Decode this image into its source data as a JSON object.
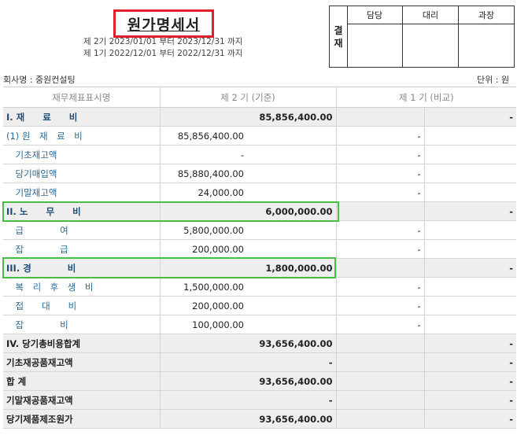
{
  "title": "원가명세서",
  "periods": {
    "line1": "제 2기 2023/01/01 부터 2023/12/31 까지",
    "line2": "제 1기 2022/12/01 부터 2022/12/31 까지"
  },
  "approval": {
    "label_top": "결",
    "label_bottom": "재",
    "columns": [
      "담당",
      "대리",
      "과장"
    ]
  },
  "company": "회사명 : 중원컨설팅",
  "unit": "단위 : 원",
  "headers": {
    "name": "재무제표표시명",
    "current": "제 2 기 (기준)",
    "prior": "제 1 기 (비교)"
  },
  "rows": [
    {
      "type": "sec",
      "label": "I. 재　　료　　비",
      "c1": "",
      "c2": "85,856,400.00",
      "p1": "",
      "p2": "-"
    },
    {
      "type": "item",
      "label": "(1) 원　재　료　비",
      "c1": "85,856,400.00",
      "c2": "",
      "p1": "-",
      "p2": ""
    },
    {
      "type": "item",
      "label": "　기초재고액",
      "c1": "-",
      "c2": "",
      "p1": "-",
      "p2": ""
    },
    {
      "type": "item",
      "label": "　당기매입액",
      "c1": "85,880,400.00",
      "c2": "",
      "p1": "-",
      "p2": ""
    },
    {
      "type": "item",
      "label": "　기말재고액",
      "c1": "24,000.00",
      "c2": "",
      "p1": "-",
      "p2": ""
    },
    {
      "type": "sec",
      "label": "II. 노　　무　　비",
      "c1": "",
      "c2": "6,000,000.00",
      "p1": "",
      "p2": "-"
    },
    {
      "type": "item",
      "label": "　급　　　　여",
      "c1": "5,800,000.00",
      "c2": "",
      "p1": "-",
      "p2": ""
    },
    {
      "type": "item",
      "label": "　잡　　　　급",
      "c1": "200,000.00",
      "c2": "",
      "p1": "-",
      "p2": ""
    },
    {
      "type": "sec",
      "label": "III. 경　　　　비",
      "c1": "",
      "c2": "1,800,000.00",
      "p1": "",
      "p2": "-"
    },
    {
      "type": "item",
      "label": "　복　리　후　생　비",
      "c1": "1,500,000.00",
      "c2": "",
      "p1": "-",
      "p2": ""
    },
    {
      "type": "item",
      "label": "　접　　대　　비",
      "c1": "200,000.00",
      "c2": "",
      "p1": "-",
      "p2": ""
    },
    {
      "type": "item",
      "label": "　잡　　　　비",
      "c1": "100,000.00",
      "c2": "",
      "p1": "-",
      "p2": ""
    },
    {
      "type": "tot",
      "label": "IV. 당기총비용합계",
      "c1": "",
      "c2": "93,656,400.00",
      "p1": "",
      "p2": "-"
    },
    {
      "type": "tot",
      "label": "기초재공품재고액",
      "c1": "",
      "c2": "-",
      "p1": "",
      "p2": "-"
    },
    {
      "type": "tot",
      "label": "합 계",
      "c1": "",
      "c2": "93,656,400.00",
      "p1": "",
      "p2": "-"
    },
    {
      "type": "tot",
      "label": "기말재공품재고액",
      "c1": "",
      "c2": "-",
      "p1": "",
      "p2": "-"
    },
    {
      "type": "tot",
      "label": "당기제품제조원가",
      "c1": "",
      "c2": "93,656,400.00",
      "p1": "",
      "p2": "-"
    }
  ],
  "colors": {
    "title_box": "#e0202a",
    "highlight": "#45c045",
    "section_bg": "#eeeeee",
    "label_blue": "#2d6b94"
  }
}
